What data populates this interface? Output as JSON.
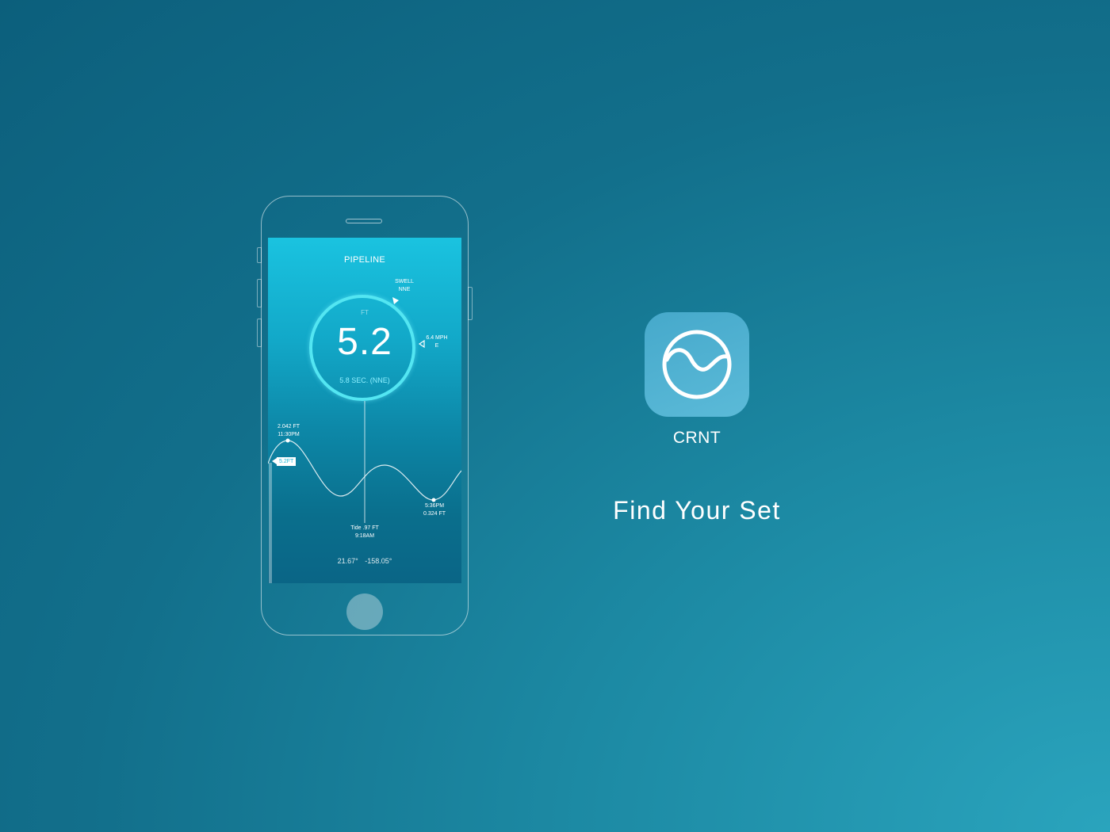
{
  "app": {
    "name": "CRNT",
    "tagline": "Find Your Set",
    "icon": "wave-circle-icon",
    "colors": {
      "background": "#126f8b",
      "accent": "#53e6f2",
      "icon_bg": "#50b3d3"
    }
  },
  "screen": {
    "location": "PIPELINE",
    "swell": {
      "label": "SWELL",
      "direction": "NNE"
    },
    "wind": {
      "speed": "6.4 MPH",
      "direction": "E"
    },
    "height": {
      "unit": "FT",
      "value": "5.2",
      "period": "5.8 SEC. (NNE)"
    },
    "tide": {
      "current_tag": "5.2FT",
      "high": {
        "height": "2.042 FT",
        "time": "11:30PM"
      },
      "low": {
        "time": "5:36PM",
        "height": "0.324 FT"
      },
      "now": {
        "label": "Tide",
        "height": ".97 FT",
        "time": "9:18AM"
      }
    },
    "coords": {
      "lat": "21.67°",
      "lon": "-158.05°"
    }
  }
}
